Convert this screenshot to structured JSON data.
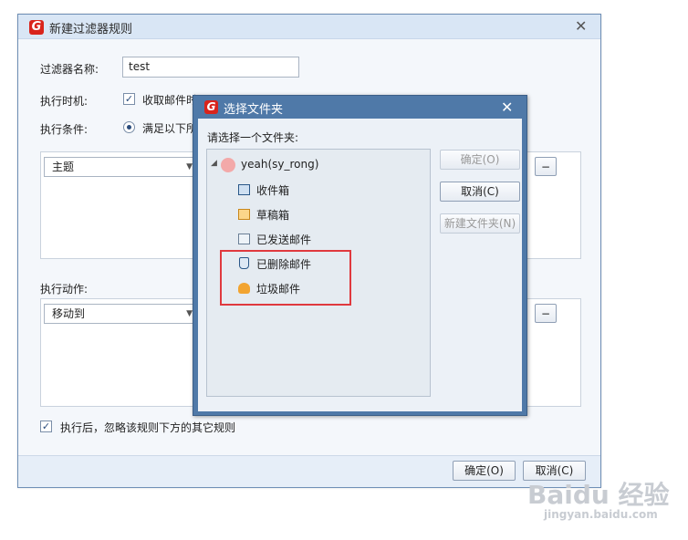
{
  "main_dialog": {
    "title": "新建过滤器规则",
    "close_glyph": "✕",
    "logo_glyph": "G",
    "filter_name_label": "过滤器名称:",
    "filter_name_value": "test",
    "exec_time_label": "执行时机:",
    "exec_time_option": "收取邮件时",
    "exec_cond_label": "执行条件:",
    "exec_cond_option": "满足以下所",
    "condition_select": "主题",
    "minus_glyph": "−",
    "actions_label": "执行动作:",
    "action_select": "移动到",
    "ignore_rules_label": "执行后，忽略该规则下方的其它规则",
    "ok_button": "确定(O)",
    "cancel_button": "取消(C)"
  },
  "folder_dialog": {
    "title": "选择文件夹",
    "close_glyph": "✕",
    "prompt": "请选择一个文件夹:",
    "account": "yeah(sy_rong)",
    "folders": [
      "收件箱",
      "草稿箱",
      "已发送邮件",
      "已删除邮件",
      "垃圾邮件"
    ],
    "ok_button": "确定(O)",
    "cancel_button": "取消(C)",
    "new_folder_button": "新建文件夹(N)"
  },
  "watermark": {
    "brand": "Baidu 经验",
    "url": "jingyan.baidu.com"
  },
  "colors": {
    "highlight_box": "#e0393e",
    "title_bar": "#4f79a8"
  }
}
